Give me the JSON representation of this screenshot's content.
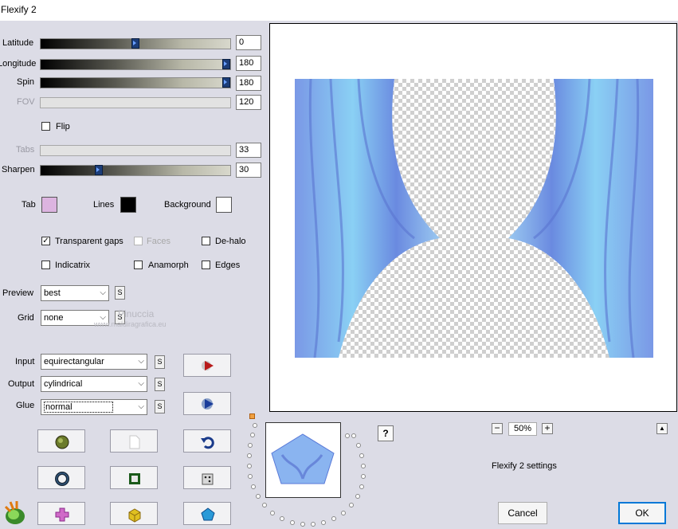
{
  "window": {
    "title": "Flexify 2"
  },
  "sliders": [
    {
      "label": "Latitude",
      "value": "0",
      "level": 0.49,
      "enabled": true
    },
    {
      "label": "Longitude",
      "value": "180",
      "level": 1.0,
      "enabled": true
    },
    {
      "label": "Spin",
      "value": "180",
      "level": 1.0,
      "enabled": true
    },
    {
      "label": "FOV",
      "value": "120",
      "enabled": false
    },
    {
      "label": "Tabs",
      "value": "33",
      "enabled": false
    },
    {
      "label": "Sharpen",
      "value": "30",
      "level": 0.3,
      "enabled": true
    }
  ],
  "flip": {
    "label": "Flip",
    "checked": false
  },
  "colors": {
    "tab": {
      "label": "Tab",
      "color": "#dcb4e0"
    },
    "lines": {
      "label": "Lines",
      "color": "#000000"
    },
    "background": {
      "label": "Background",
      "color": "#ffffff"
    }
  },
  "options": {
    "transparent_gaps": {
      "label": "Transparent gaps",
      "checked": true
    },
    "faces": {
      "label": "Faces",
      "checked": false,
      "enabled": false
    },
    "de_halo": {
      "label": "De-halo",
      "checked": false
    },
    "indicatrix": {
      "label": "Indicatrix",
      "checked": false
    },
    "anamorph": {
      "label": "Anamorph",
      "checked": false
    },
    "edges": {
      "label": "Edges",
      "checked": false
    }
  },
  "preview": {
    "label": "Preview",
    "value": "best",
    "s": "S"
  },
  "grid": {
    "label": "Grid",
    "value": "none",
    "s": "S"
  },
  "input": {
    "label": "Input",
    "value": "equirectangular",
    "s": "S"
  },
  "output": {
    "label": "Output",
    "value": "cylindrical",
    "s": "S"
  },
  "glue": {
    "label": "Glue",
    "value": "normal",
    "s": "S"
  },
  "watermark": {
    "text": "Pinuccia",
    "subtext": "www.maldiragrafica.eu"
  },
  "help": "?",
  "zoom": {
    "value": "50%",
    "minus": "−",
    "plus": "+"
  },
  "collapse": "▲",
  "settings_label": "Flexify 2 settings",
  "buttons": {
    "cancel": "Cancel",
    "ok": "OK"
  },
  "icons": {
    "tool_row1": [
      "globe-icon",
      "page-icon",
      "undo-icon"
    ],
    "tool_row2": [
      "ring-icon",
      "square-icon",
      "dice-icon"
    ],
    "tool_row3": [
      "cross-icon",
      "cube-icon",
      "pentagon-icon"
    ],
    "side": [
      "play-arrow-icon",
      "play-disc-icon"
    ],
    "logo": "flexify-logo-icon"
  },
  "accent": "#0078d7",
  "curtain_color": "#7aa8ee"
}
